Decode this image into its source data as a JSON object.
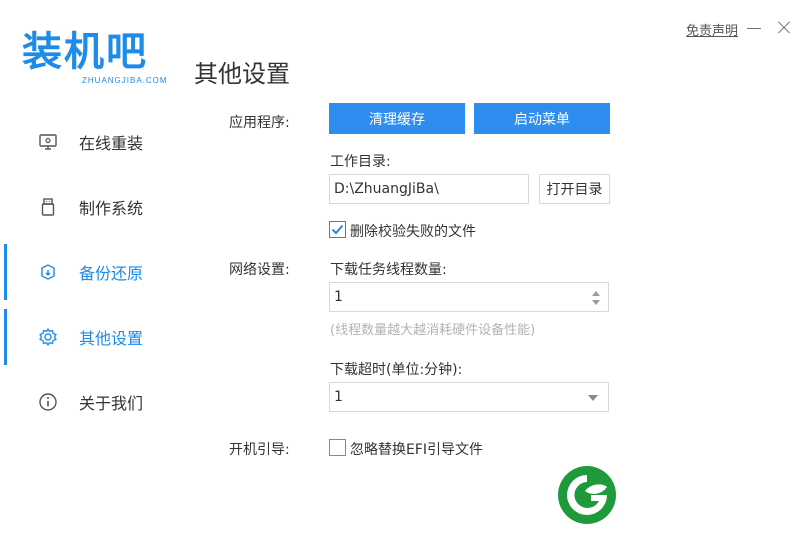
{
  "app": {
    "logo_text": "装机吧",
    "logo_sub": "ZHUANGJIBA.COM",
    "title": "其他设置",
    "disclaimer": "免责声明"
  },
  "colors": {
    "accent": "#1e8be8",
    "button": "#2e8ef0",
    "green": "#1f9a3a"
  },
  "sidebar": {
    "items": [
      {
        "label": "在线重装",
        "icon": "monitor-icon"
      },
      {
        "label": "制作系统",
        "icon": "usb-drive-icon"
      },
      {
        "label": "备份还原",
        "icon": "backup-restore-icon"
      },
      {
        "label": "其他设置",
        "icon": "gear-icon"
      },
      {
        "label": "关于我们",
        "icon": "info-icon"
      }
    ]
  },
  "app_section": {
    "label": "应用程序:",
    "clear_cache": "清理缓存",
    "boot_menu": "启动菜单",
    "workdir_label": "工作目录:",
    "workdir_value": "D:\\ZhuangJiBa\\",
    "open_dir": "打开目录",
    "delete_failed": "删除校验失败的文件",
    "delete_failed_checked": true
  },
  "network_section": {
    "label": "网络设置:",
    "threads_label": "下载任务线程数量:",
    "threads_value": "1",
    "threads_hint": "(线程数量越大越消耗硬件设备性能)",
    "timeout_label": "下载超时(单位:分钟):",
    "timeout_value": "1"
  },
  "boot_section": {
    "label": "开机引导:",
    "ignore_efi": "忽略替换EFI引导文件",
    "ignore_efi_checked": false
  }
}
